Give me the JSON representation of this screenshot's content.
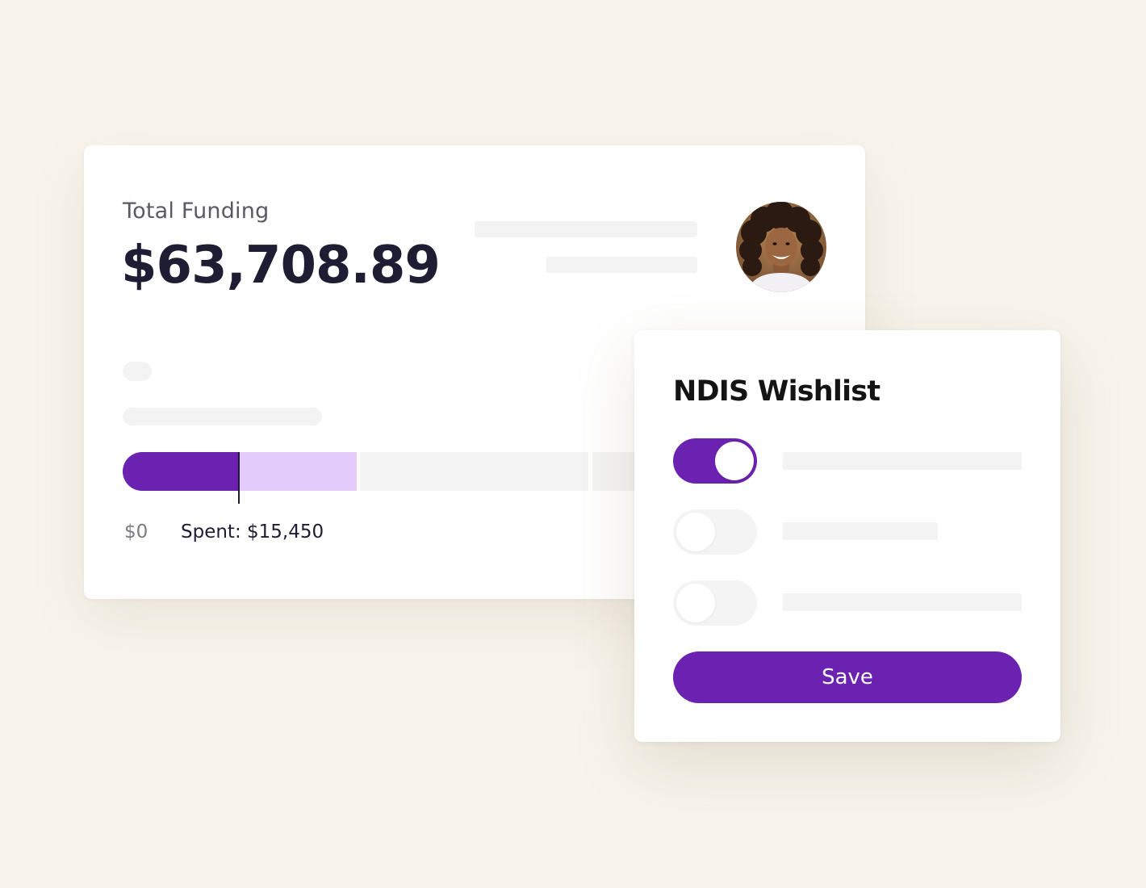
{
  "funding": {
    "label": "Total Funding",
    "amount": "$63,708.89",
    "axis_start": "$0",
    "spent_label": "Spent: $15,450",
    "avatar": "person-avatar",
    "lock_icon": "lock-icon"
  },
  "wishlist": {
    "title": "NDIS Wishlist",
    "toggles": [
      {
        "state": "on"
      },
      {
        "state": "off"
      },
      {
        "state": "off"
      }
    ],
    "save_label": "Save"
  },
  "colors": {
    "background": "#f8f4ec",
    "accent": "#6c22b0",
    "accent_light": "#e3ccfb",
    "text_dark": "#1f1d33",
    "skeleton": "#f3f3f3"
  }
}
